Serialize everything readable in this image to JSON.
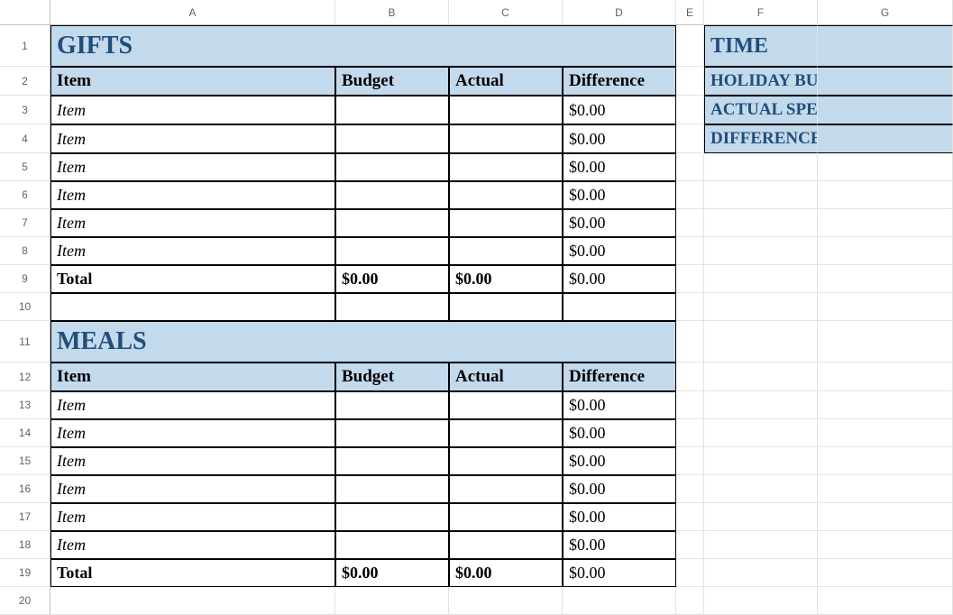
{
  "columns": [
    "A",
    "B",
    "C",
    "D",
    "E",
    "F",
    "G"
  ],
  "rows": [
    "1",
    "2",
    "3",
    "4",
    "5",
    "6",
    "7",
    "8",
    "9",
    "10",
    "11",
    "12",
    "13",
    "14",
    "15",
    "16",
    "17",
    "18",
    "19",
    "20"
  ],
  "gifts": {
    "title": "GIFTS",
    "headers": {
      "item": "Item",
      "budget": "Budget",
      "actual": "Actual",
      "diff": "Difference"
    },
    "items": [
      {
        "name": "Item",
        "budget": "",
        "actual": "",
        "diff": "$0.00"
      },
      {
        "name": "Item",
        "budget": "",
        "actual": "",
        "diff": "$0.00"
      },
      {
        "name": "Item",
        "budget": "",
        "actual": "",
        "diff": "$0.00"
      },
      {
        "name": "Item",
        "budget": "",
        "actual": "",
        "diff": "$0.00"
      },
      {
        "name": "Item",
        "budget": "",
        "actual": "",
        "diff": "$0.00"
      },
      {
        "name": "Item",
        "budget": "",
        "actual": "",
        "diff": "$0.00"
      }
    ],
    "total": {
      "label": "Total",
      "budget": "$0.00",
      "actual": "$0.00",
      "diff": "$0.00"
    }
  },
  "meals": {
    "title": "MEALS",
    "headers": {
      "item": "Item",
      "budget": "Budget",
      "actual": "Actual",
      "diff": "Difference"
    },
    "items": [
      {
        "name": "Item",
        "budget": "",
        "actual": "",
        "diff": "$0.00"
      },
      {
        "name": "Item",
        "budget": "",
        "actual": "",
        "diff": "$0.00"
      },
      {
        "name": "Item",
        "budget": "",
        "actual": "",
        "diff": "$0.00"
      },
      {
        "name": "Item",
        "budget": "",
        "actual": "",
        "diff": "$0.00"
      },
      {
        "name": "Item",
        "budget": "",
        "actual": "",
        "diff": "$0.00"
      },
      {
        "name": "Item",
        "budget": "",
        "actual": "",
        "diff": "$0.00"
      }
    ],
    "total": {
      "label": "Total",
      "budget": "$0.00",
      "actual": "$0.00",
      "diff": "$0.00"
    }
  },
  "summary": {
    "time": "TIME",
    "holiday_budget": "HOLIDAY BUDGET",
    "actual_spent": "ACTUAL SPENT",
    "difference": "DIFFERENCE"
  }
}
